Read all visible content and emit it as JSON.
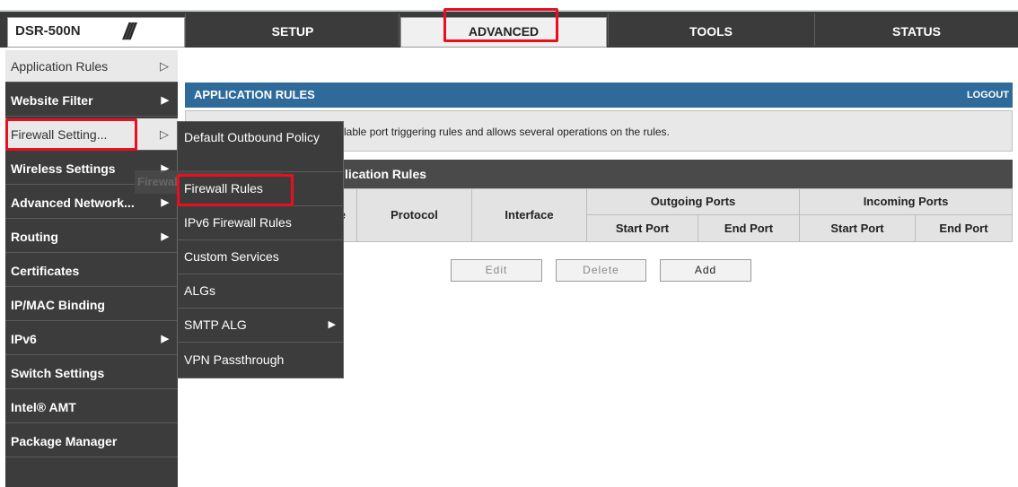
{
  "header": {
    "brand": "DSR-500N",
    "tabs": [
      {
        "label": "SETUP"
      },
      {
        "label": "ADVANCED"
      },
      {
        "label": "TOOLS"
      },
      {
        "label": "STATUS"
      }
    ]
  },
  "left_menu": {
    "items": [
      {
        "label": "Application Rules"
      },
      {
        "label": "Website Filter"
      },
      {
        "label": "Firewall Setting..."
      },
      {
        "label": "Wireless Settings"
      },
      {
        "label": "Advanced Network..."
      },
      {
        "label": "Routing"
      },
      {
        "label": "Certificates"
      },
      {
        "label": "IP/MAC Binding"
      },
      {
        "label": "IPv6"
      },
      {
        "label": "Switch Settings"
      },
      {
        "label": "Intel® AMT"
      },
      {
        "label": "Package Manager"
      }
    ],
    "tooltip": "Firewall Settings"
  },
  "submenu": {
    "items": [
      {
        "label": "Default Outbound Policy"
      },
      {
        "label": "Firewall Rules"
      },
      {
        "label": "IPv6 Firewall Rules"
      },
      {
        "label": "Custom Services"
      },
      {
        "label": "ALGs"
      },
      {
        "label": "SMTP ALG"
      },
      {
        "label": "VPN Passthrough"
      }
    ]
  },
  "main": {
    "page_title": "APPLICATION RULES",
    "logout": "LOGOUT",
    "description": "This page lists the available port triggering rules and allows several operations on the rules.",
    "description_visible": "lable port triggering rules and allows several operations on the rules.",
    "table_title": "List of Available Application Rules",
    "table_title_visible": "lication Rules",
    "columns": {
      "name_partial": "le",
      "protocol": "Protocol",
      "interface": "Interface",
      "outgoing": "Outgoing Ports",
      "incoming": "Incoming Ports",
      "out_start": "Start Port",
      "out_end": "End Port",
      "in_start": "Start Port",
      "in_end": "End Port"
    },
    "buttons": {
      "edit": "Edit",
      "delete": "Delete",
      "add": "Add"
    }
  },
  "colors": {
    "highlight": "#e8101f",
    "page_header": "#2e6a9a",
    "menu_bg": "#3c3c3c"
  }
}
